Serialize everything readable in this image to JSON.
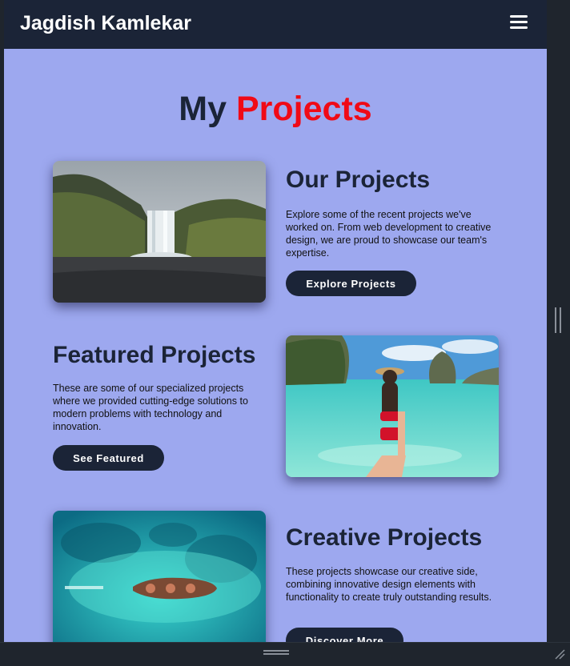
{
  "navbar": {
    "brand": "Jagdish Kamlekar",
    "menu_icon": "hamburger-menu-icon"
  },
  "heading": {
    "part1": "My",
    "part2": "Projects"
  },
  "projects": [
    {
      "title": "Our Projects",
      "description": "Explore some of the recent projects we've worked on. From web development to creative design, we are proud to showcase our team's expertise.",
      "button": "Explore Projects",
      "image": "waterfall-landscape"
    },
    {
      "title": "Featured Projects",
      "description": "These are some of our specialized projects where we provided cutting-edge solutions to modern problems with technology and innovation.",
      "button": "See Featured",
      "image": "beach-woman-hat"
    },
    {
      "title": "Creative Projects",
      "description": "These projects showcase our creative side, combining innovative design elements with functionality to create truly outstanding results.",
      "button": "Discover More",
      "image": "aerial-shipwreck"
    }
  ],
  "colors": {
    "navbar": "#1b2437",
    "page": "#9da8ef",
    "accent": "#f00a16"
  }
}
